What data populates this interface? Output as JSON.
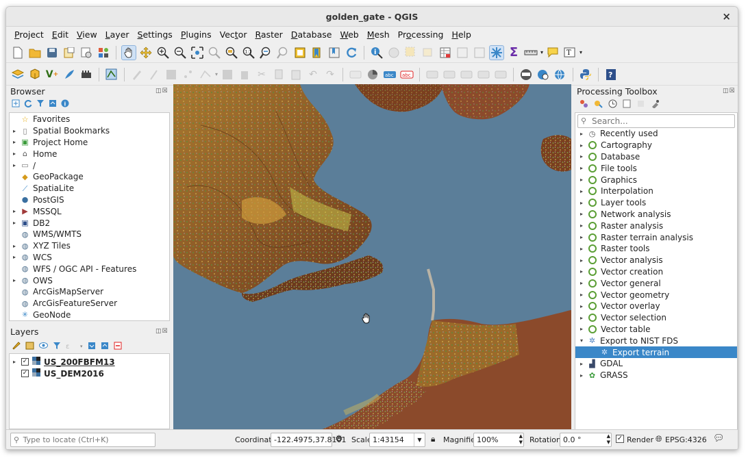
{
  "window": {
    "title": "golden_gate - QGIS",
    "close_glyph": "×"
  },
  "menu": [
    "Project",
    "Edit",
    "View",
    "Layer",
    "Settings",
    "Plugins",
    "Vector",
    "Raster",
    "Database",
    "Web",
    "Mesh",
    "Processing",
    "Help"
  ],
  "menu_underline": [
    "P",
    "E",
    "V",
    "L",
    "S",
    "P",
    "t",
    "R",
    "D",
    "W",
    "M",
    "o",
    "H"
  ],
  "browser": {
    "title": "Browser",
    "items": [
      {
        "label": "Favorites",
        "icon": "star-icon",
        "expand": false
      },
      {
        "label": "Spatial Bookmarks",
        "icon": "bookmark-icon",
        "expand": true
      },
      {
        "label": "Project Home",
        "icon": "folder-home-icon",
        "expand": true
      },
      {
        "label": "Home",
        "icon": "home-icon",
        "expand": true
      },
      {
        "label": "/",
        "icon": "folder-icon",
        "expand": true
      },
      {
        "label": "GeoPackage",
        "icon": "geopackage-icon",
        "expand": false
      },
      {
        "label": "SpatiaLite",
        "icon": "spatialite-icon",
        "expand": false
      },
      {
        "label": "PostGIS",
        "icon": "postgis-icon",
        "expand": false
      },
      {
        "label": "MSSQL",
        "icon": "mssql-icon",
        "expand": true
      },
      {
        "label": "DB2",
        "icon": "db2-icon",
        "expand": true
      },
      {
        "label": "WMS/WMTS",
        "icon": "globe-icon",
        "expand": false
      },
      {
        "label": "XYZ Tiles",
        "icon": "globe-icon",
        "expand": true
      },
      {
        "label": "WCS",
        "icon": "globe-icon",
        "expand": true
      },
      {
        "label": "WFS / OGC API - Features",
        "icon": "globe-icon",
        "expand": false
      },
      {
        "label": "OWS",
        "icon": "globe-icon",
        "expand": true
      },
      {
        "label": "ArcGisMapServer",
        "icon": "globe-icon",
        "expand": false
      },
      {
        "label": "ArcGisFeatureServer",
        "icon": "globe-icon",
        "expand": false
      },
      {
        "label": "GeoNode",
        "icon": "geonode-icon",
        "expand": false
      }
    ]
  },
  "layers": {
    "title": "Layers",
    "items": [
      {
        "label": "US_200FBFM13",
        "checked": true,
        "expand": true
      },
      {
        "label": "US_DEM2016",
        "checked": true,
        "expand": false
      }
    ]
  },
  "processing": {
    "title": "Processing Toolbox",
    "search_placeholder": "Search...",
    "items": [
      {
        "label": "Recently used",
        "icon": "clock",
        "level": 0,
        "arrow": "▸"
      },
      {
        "label": "Cartography",
        "icon": "qgis",
        "level": 0,
        "arrow": "▸"
      },
      {
        "label": "Database",
        "icon": "qgis",
        "level": 0,
        "arrow": "▸"
      },
      {
        "label": "File tools",
        "icon": "qgis",
        "level": 0,
        "arrow": "▸"
      },
      {
        "label": "Graphics",
        "icon": "qgis",
        "level": 0,
        "arrow": "▸"
      },
      {
        "label": "Interpolation",
        "icon": "qgis",
        "level": 0,
        "arrow": "▸"
      },
      {
        "label": "Layer tools",
        "icon": "qgis",
        "level": 0,
        "arrow": "▸"
      },
      {
        "label": "Network analysis",
        "icon": "qgis",
        "level": 0,
        "arrow": "▸"
      },
      {
        "label": "Raster analysis",
        "icon": "qgis",
        "level": 0,
        "arrow": "▸"
      },
      {
        "label": "Raster terrain analysis",
        "icon": "qgis",
        "level": 0,
        "arrow": "▸"
      },
      {
        "label": "Raster tools",
        "icon": "qgis",
        "level": 0,
        "arrow": "▸"
      },
      {
        "label": "Vector analysis",
        "icon": "qgis",
        "level": 0,
        "arrow": "▸"
      },
      {
        "label": "Vector creation",
        "icon": "qgis",
        "level": 0,
        "arrow": "▸"
      },
      {
        "label": "Vector general",
        "icon": "qgis",
        "level": 0,
        "arrow": "▸"
      },
      {
        "label": "Vector geometry",
        "icon": "qgis",
        "level": 0,
        "arrow": "▸"
      },
      {
        "label": "Vector overlay",
        "icon": "qgis",
        "level": 0,
        "arrow": "▸"
      },
      {
        "label": "Vector selection",
        "icon": "qgis",
        "level": 0,
        "arrow": "▸"
      },
      {
        "label": "Vector table",
        "icon": "qgis",
        "level": 0,
        "arrow": "▸"
      },
      {
        "label": "Export to NIST FDS",
        "icon": "gear",
        "level": 0,
        "arrow": "▾"
      },
      {
        "label": "Export terrain",
        "icon": "gear",
        "level": 1,
        "arrow": "",
        "selected": true
      },
      {
        "label": "GDAL",
        "icon": "gdal",
        "level": 0,
        "arrow": "▸"
      },
      {
        "label": "GRASS",
        "icon": "grass",
        "level": 0,
        "arrow": "▸"
      }
    ]
  },
  "status": {
    "locate_placeholder": "Type to locate (Ctrl+K)",
    "coordinate_label": "Coordinate",
    "coordinate_value": "-122.4975,37.8101",
    "scale_label": "Scale",
    "scale_value": "1:43154",
    "magnifier_label": "Magnifier",
    "magnifier_value": "100%",
    "rotation_label": "Rotation",
    "rotation_value": "0.0 °",
    "render_label": "Render",
    "render_checked": true,
    "crs": "EPSG:4326"
  },
  "colors": {
    "selection": "#3a87c8",
    "water": "#5a7d98",
    "land": "#8b4a2b",
    "qgis_green": "#5a9e34"
  }
}
